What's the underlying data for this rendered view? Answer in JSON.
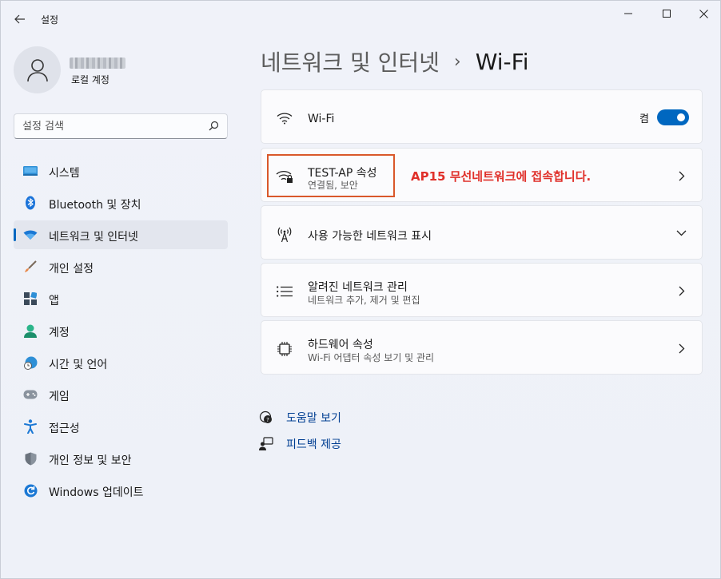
{
  "window": {
    "app_title": "설정",
    "back_icon": "back-arrow-icon",
    "controls": [
      "minimize-icon",
      "maximize-icon",
      "close-icon"
    ]
  },
  "profile": {
    "account_type": "로컬 계정"
  },
  "search": {
    "placeholder": "설정 검색"
  },
  "nav": {
    "items": [
      {
        "label": "시스템",
        "icon": "monitor-icon",
        "active": false
      },
      {
        "label": "Bluetooth 및 장치",
        "icon": "bluetooth-icon",
        "active": false
      },
      {
        "label": "네트워크 및 인터넷",
        "icon": "wifi-icon",
        "active": true
      },
      {
        "label": "개인 설정",
        "icon": "brush-icon",
        "active": false
      },
      {
        "label": "앱",
        "icon": "apps-icon",
        "active": false
      },
      {
        "label": "계정",
        "icon": "person-icon",
        "active": false
      },
      {
        "label": "시간 및 언어",
        "icon": "clock-globe-icon",
        "active": false
      },
      {
        "label": "게임",
        "icon": "gamepad-icon",
        "active": false
      },
      {
        "label": "접근성",
        "icon": "accessibility-icon",
        "active": false
      },
      {
        "label": "개인 정보 및 보안",
        "icon": "shield-icon",
        "active": false
      },
      {
        "label": "Windows 업데이트",
        "icon": "update-icon",
        "active": false
      }
    ]
  },
  "breadcrumb": {
    "parent": "네트워크 및 인터넷",
    "separator": "›",
    "current": "Wi-Fi"
  },
  "cards": {
    "wifi": {
      "title": "Wi-Fi",
      "toggle_label": "켬",
      "toggle_on": true
    },
    "connected": {
      "title": "TEST-AP 속성",
      "subtitle": "연결됨, 보안",
      "annotation": "AP15 무선네트워크에 접속합니다."
    },
    "available": {
      "title": "사용 가능한 네트워크 표시"
    },
    "known": {
      "title": "알려진 네트워크 관리",
      "subtitle": "네트워크 추가, 제거 및 편집"
    },
    "hardware": {
      "title": "하드웨어 속성",
      "subtitle": "Wi-Fi 어댑터 속성 보기 및 관리"
    }
  },
  "links": {
    "help": "도움말 보기",
    "feedback": "피드백 제공"
  },
  "colors": {
    "accent": "#0067c0",
    "annotation": "#e0302a",
    "highlight_border": "#d9582b",
    "link": "#003e92"
  }
}
